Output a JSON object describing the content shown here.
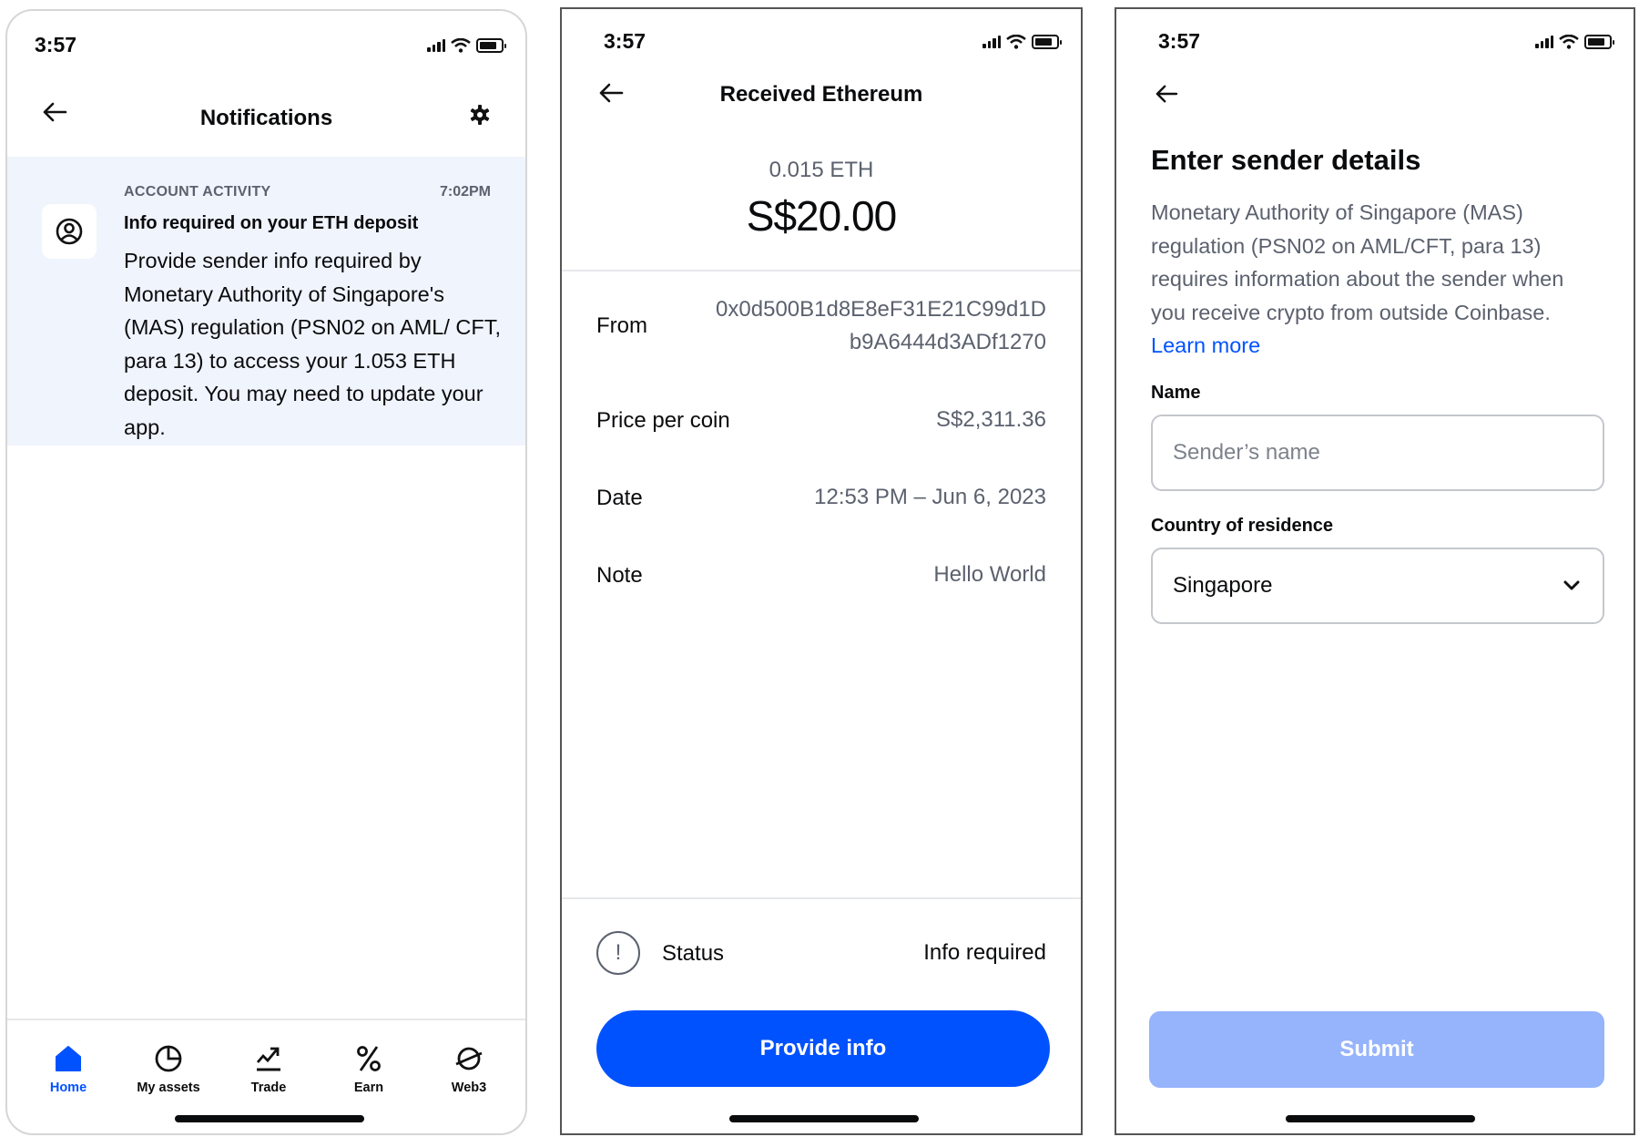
{
  "status_bar": {
    "time": "3:57"
  },
  "notifications_screen": {
    "title": "Notifications",
    "notification": {
      "category": "ACCOUNT ACTIVITY",
      "time": "7:02PM",
      "title": "Info required on your ETH deposit",
      "body": "Provide sender info required by Monetary Authority of Singapore's (MAS) regulation (PSN02 on AML/ CFT, para 13) to access your 1.053 ETH deposit. You may need to update your app."
    },
    "tabs": [
      {
        "label": "Home",
        "icon": "home-icon",
        "active": true
      },
      {
        "label": "My assets",
        "icon": "pie-chart-icon",
        "active": false
      },
      {
        "label": "Trade",
        "icon": "trend-up-icon",
        "active": false
      },
      {
        "label": "Earn",
        "icon": "percent-icon",
        "active": false
      },
      {
        "label": "Web3",
        "icon": "planet-icon",
        "active": false
      }
    ]
  },
  "transaction_screen": {
    "title": "Received Ethereum",
    "amount_crypto": "0.015 ETH",
    "amount_fiat": "S$20.00",
    "rows": [
      {
        "label": "From",
        "value_line1": "0x0d500B1d8E8eF31E21C99d1D",
        "value_line2": "b9A6444d3ADf1270"
      },
      {
        "label": "Price per coin",
        "value": "S$2,311.36"
      },
      {
        "label": "Date",
        "value": "12:53 PM – Jun 6, 2023"
      },
      {
        "label": "Note",
        "value": "Hello World"
      }
    ],
    "status_label": "Status",
    "status_value": "Info required",
    "status_icon_glyph": "!",
    "primary_button": "Provide info"
  },
  "sender_screen": {
    "heading": "Enter sender details",
    "description": "Monetary Authority of Singapore (MAS) regulation (PSN02 on AML/CFT, para 13) requires information about the sender when you receive crypto from outside Coinbase.",
    "learn_more": "Learn more",
    "name_label": "Name",
    "name_placeholder": "Sender’s name",
    "name_value": "",
    "country_label": "Country of residence",
    "country_value": "Singapore",
    "submit_button": "Submit"
  },
  "colors": {
    "accent": "#0052ff",
    "disabled_button": "#96b4fb",
    "notification_bg": "#f0f4fd",
    "secondary_text": "#5b616e"
  }
}
